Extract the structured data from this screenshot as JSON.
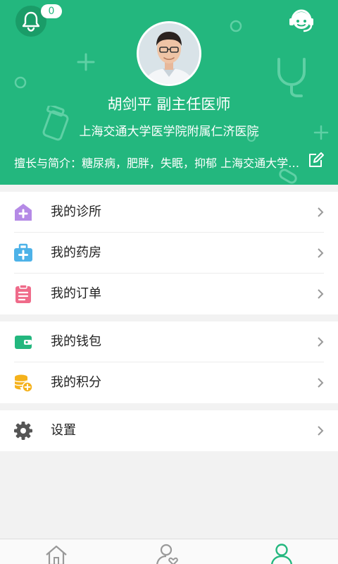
{
  "header": {
    "notification_count": "0",
    "doctor_name": "胡剑平 副主任医师",
    "hospital": "上海交通大学医学院附属仁济医院",
    "intro": "擅长与简介：糖尿病，肥胖，失眠，抑郁 上海交通大学医学院附属仁济医院",
    "colors": {
      "brand": "#23b77e",
      "brand_dark": "#1a9c68"
    }
  },
  "menu": {
    "group1": [
      {
        "label": "我的诊所",
        "icon": "clinic-plus-icon",
        "color": "#b58ae6"
      },
      {
        "label": "我的药房",
        "icon": "medicine-box-icon",
        "color": "#4db2e8"
      },
      {
        "label": "我的订单",
        "icon": "clipboard-icon",
        "color": "#ef6b8a"
      }
    ],
    "group2": [
      {
        "label": "我的钱包",
        "icon": "wallet-icon",
        "color": "#23b77e"
      },
      {
        "label": "我的积分",
        "icon": "coins-icon",
        "color": "#f5b21c"
      }
    ],
    "group3": [
      {
        "label": "设置",
        "icon": "gear-icon",
        "color": "#555555"
      }
    ]
  },
  "tabbar": {
    "tabs": [
      {
        "icon": "home-icon",
        "active": false
      },
      {
        "icon": "patients-icon",
        "active": false
      },
      {
        "icon": "profile-icon",
        "active": true
      }
    ]
  }
}
